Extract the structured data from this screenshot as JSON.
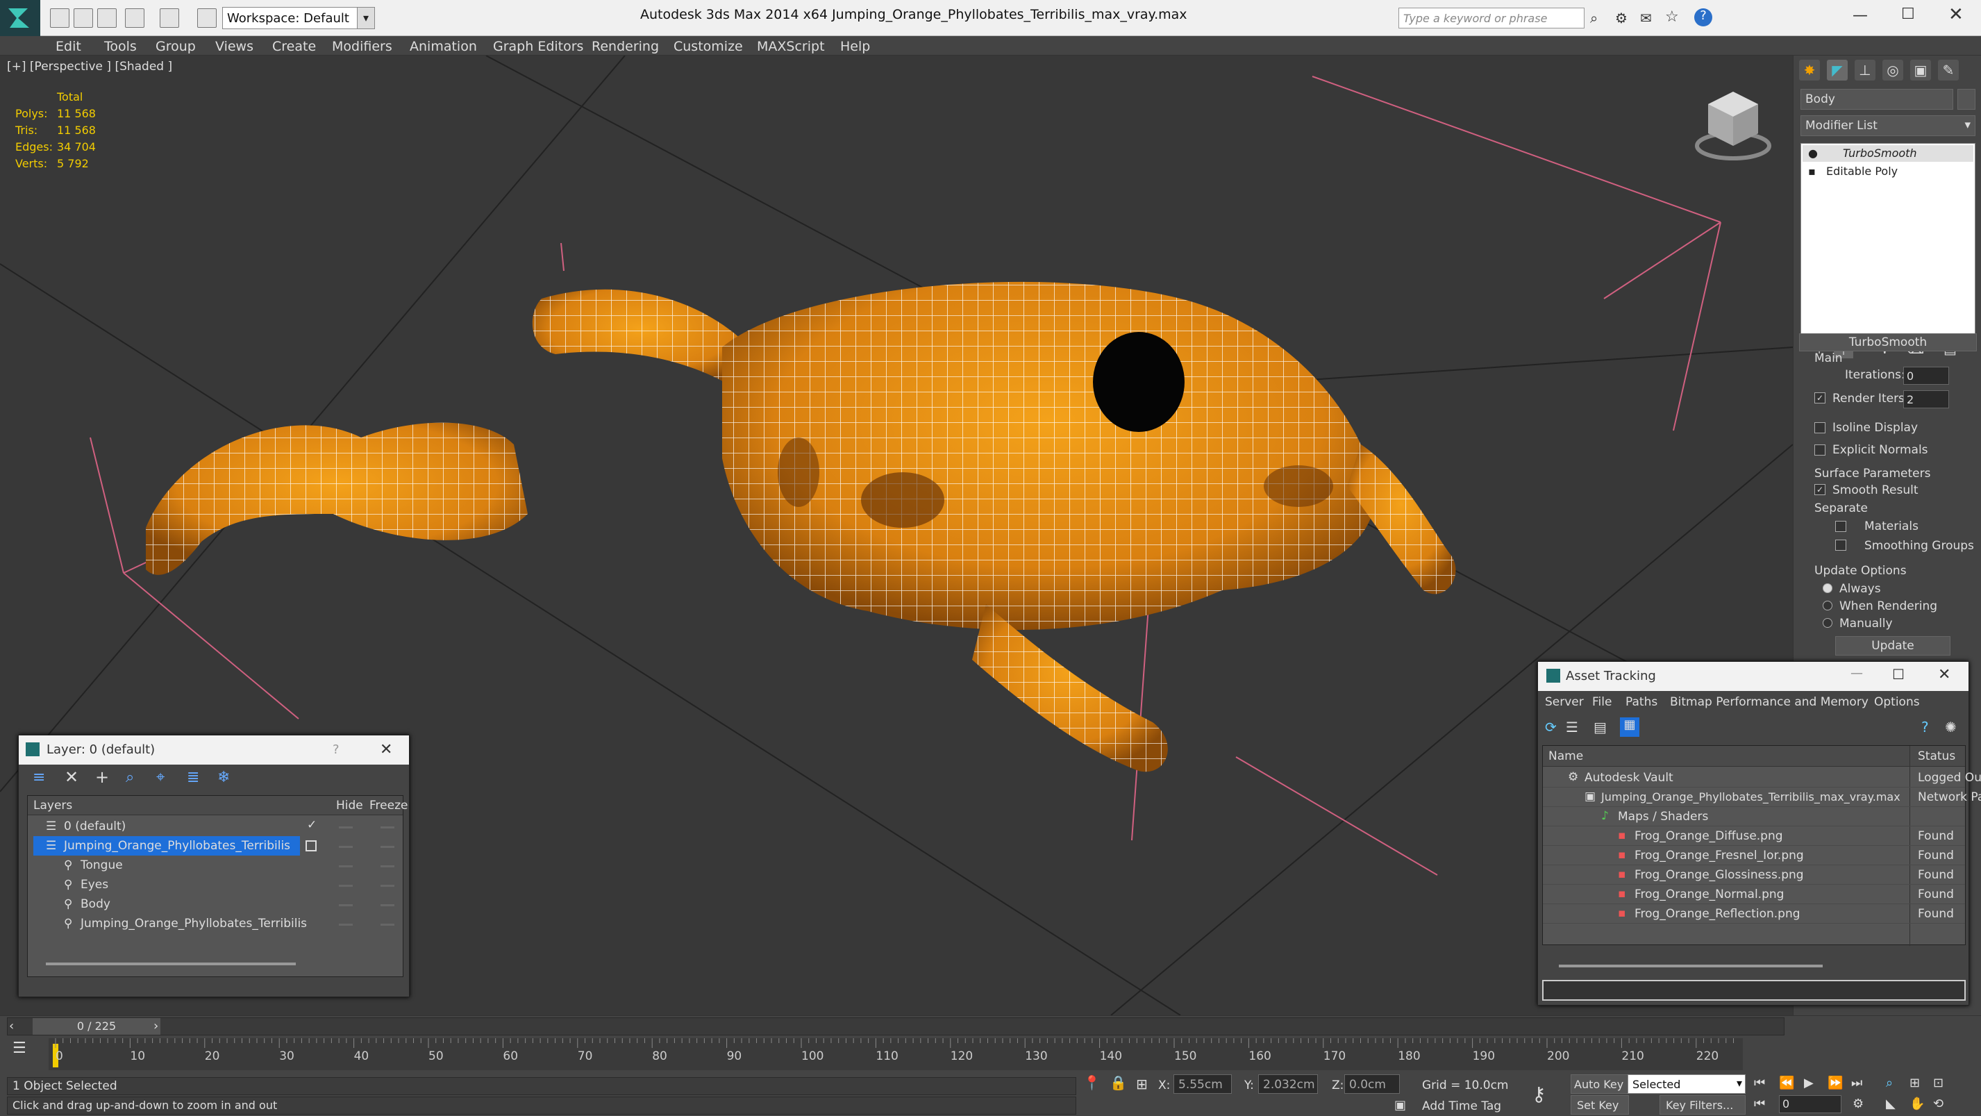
{
  "title_bar": {
    "workspace": "Workspace: Default",
    "title": "Autodesk 3ds Max  2014 x64     Jumping_Orange_Phyllobates_Terribilis_max_vray.max",
    "search_placeholder": "Type a keyword or phrase"
  },
  "menu": [
    "Edit",
    "Tools",
    "Group",
    "Views",
    "Create",
    "Modifiers",
    "Animation",
    "Graph Editors",
    "Rendering",
    "Customize",
    "MAXScript",
    "Help"
  ],
  "viewport": {
    "label": "[+] [Perspective ] [Shaded ]",
    "stats": {
      "header": "Total",
      "polys_label": "Polys:",
      "polys": "11 568",
      "tris_label": "Tris:",
      "tris": "11 568",
      "edges_label": "Edges:",
      "edges": "34 704",
      "verts_label": "Verts:",
      "verts": "5 792"
    }
  },
  "command_panel": {
    "object_name": "Body",
    "modifier_list": "Modifier List",
    "stack": [
      "TurboSmooth",
      "Editable Poly"
    ],
    "rollout_title": "TurboSmooth",
    "main_label": "Main",
    "iterations_label": "Iterations:",
    "iterations": "0",
    "render_iters_label": "Render Iters:",
    "render_iters": "2",
    "isoline": "Isoline Display",
    "explicit_normals": "Explicit Normals",
    "surface_params": "Surface Parameters",
    "smooth_result": "Smooth Result",
    "separate": "Separate",
    "materials": "Materials",
    "smoothing_groups": "Smoothing Groups",
    "update_options": "Update Options",
    "always": "Always",
    "when_rendering": "When Rendering",
    "manually": "Manually",
    "update_btn": "Update"
  },
  "layer_window": {
    "title": "Layer: 0 (default)",
    "col_layers": "Layers",
    "col_hide": "Hide",
    "col_freeze": "Freeze",
    "rows": [
      "0 (default)",
      "Jumping_Orange_Phyllobates_Terribilis",
      "Tongue",
      "Eyes",
      "Body",
      "Jumping_Orange_Phyllobates_Terribilis"
    ]
  },
  "asset_window": {
    "title": "Asset Tracking",
    "menu": [
      "Server",
      "File",
      "Paths",
      "Bitmap Performance and Memory",
      "Options"
    ],
    "col_name": "Name",
    "col_status": "Status",
    "rows": [
      {
        "name": "Autodesk Vault",
        "status": "Logged Ou"
      },
      {
        "name": "Jumping_Orange_Phyllobates_Terribilis_max_vray.max",
        "status": "Network Pa"
      },
      {
        "name": "Maps / Shaders",
        "status": ""
      },
      {
        "name": "Frog_Orange_Diffuse.png",
        "status": "Found"
      },
      {
        "name": "Frog_Orange_Fresnel_Ior.png",
        "status": "Found"
      },
      {
        "name": "Frog_Orange_Glossiness.png",
        "status": "Found"
      },
      {
        "name": "Frog_Orange_Normal.png",
        "status": "Found"
      },
      {
        "name": "Frog_Orange_Reflection.png",
        "status": "Found"
      }
    ]
  },
  "timeline": {
    "frame": "0 / 225",
    "ticks": [
      "0",
      "10",
      "20",
      "30",
      "40",
      "50",
      "60",
      "70",
      "80",
      "90",
      "100",
      "110",
      "120",
      "130",
      "140",
      "150",
      "160",
      "170",
      "180",
      "190",
      "200",
      "210",
      "220"
    ]
  },
  "status": {
    "selected": "1 Object Selected",
    "prompt": "Click and drag up-and-down to zoom in and out",
    "x_label": "X:",
    "x": "5.55cm",
    "y_label": "Y:",
    "y": "2.032cm",
    "z_label": "Z:",
    "z": "0.0cm",
    "grid": "Grid = 10.0cm",
    "auto_key": "Auto Key",
    "selected_dropdown": "Selected",
    "set_key": "Set Key",
    "key_filters": "Key Filters...",
    "add_time_tag": "Add Time Tag",
    "frame_field": "0"
  },
  "colors": {
    "accent": "#1e6fd9",
    "stats": "#f2cc00",
    "frog": "#e08a10"
  }
}
